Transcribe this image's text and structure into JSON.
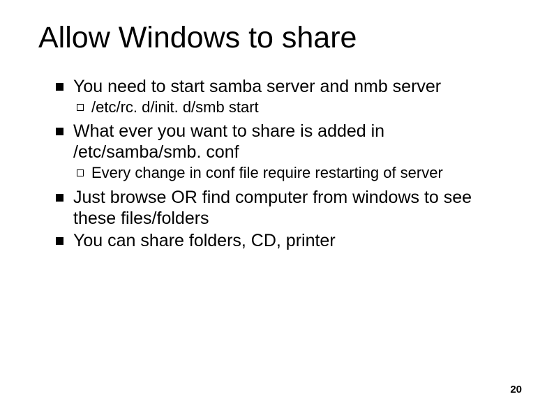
{
  "title": "Allow Windows to share",
  "bullets": [
    {
      "text": "You need to start samba server and nmb server",
      "sub": [
        {
          "text": "/etc/rc. d/init. d/smb start"
        }
      ]
    },
    {
      "text": "What ever you want to share is added in /etc/samba/smb. conf",
      "sub": [
        {
          "text": "Every change in conf file require restarting of server"
        }
      ]
    },
    {
      "text": "Just browse OR find computer from windows to see these files/folders",
      "sub": []
    },
    {
      "text": "You can share folders, CD, printer",
      "sub": []
    }
  ],
  "page_number": "20"
}
